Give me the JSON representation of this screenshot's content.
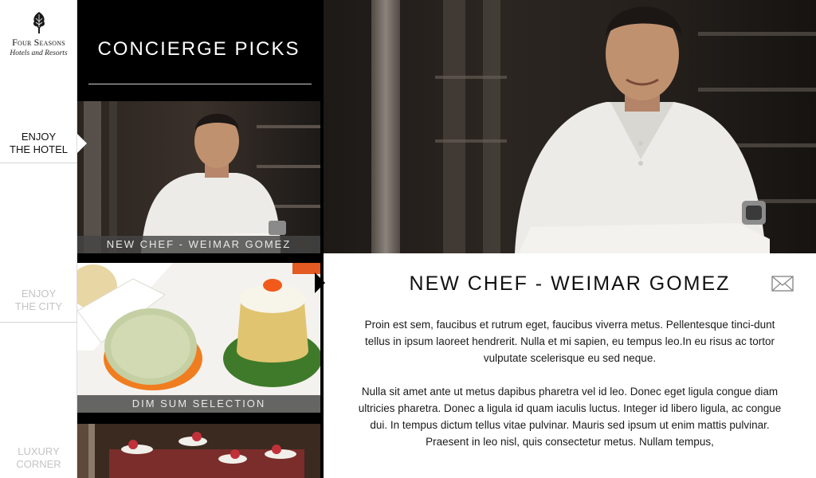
{
  "brand": {
    "name": "Four Seasons",
    "tagline": "Hotels and Resorts"
  },
  "nav": {
    "items": [
      {
        "label": "ENJOY\nTHE HOTEL",
        "active": true
      },
      {
        "label": "ENJOY\nTHE CITY",
        "active": false
      },
      {
        "label": "LUXURY\nCORNER",
        "active": false
      }
    ]
  },
  "picks": {
    "title": "CONCIERGE PICKS",
    "cards": [
      {
        "caption": "NEW CHEF - WEIMAR GOMEZ"
      },
      {
        "caption": "DIM SUM SELECTION"
      },
      {
        "caption": ""
      }
    ]
  },
  "article": {
    "title": "NEW CHEF - WEIMAR GOMEZ",
    "paragraphs": [
      "Proin est sem, faucibus et rutrum eget, faucibus viverra metus. Pellentesque tinci-dunt tellus in ipsum laoreet hendrerit. Nulla et mi sapien, eu tempus leo.In eu risus ac tortor vulputate scelerisque eu sed neque.",
      "Nulla sit amet ante ut metus dapibus pharetra vel id leo. Donec eget ligula congue diam ultricies pharetra. Donec a ligula id quam iaculis luctus. Integer id libero ligula, ac congue dui. In tempus dictum tellus vitae pulvinar. Mauris sed ipsum ut enim mattis pulvinar. Praesent in leo nisl, quis consectetur metus. Nullam tempus,"
    ]
  },
  "colors": {
    "nav_active": "#111111",
    "nav_inactive": "#c4c4c4",
    "panel": "#000000",
    "caption_bar": "#464646"
  },
  "icons": {
    "logo": "tree-icon",
    "share": "envelope-icon"
  }
}
